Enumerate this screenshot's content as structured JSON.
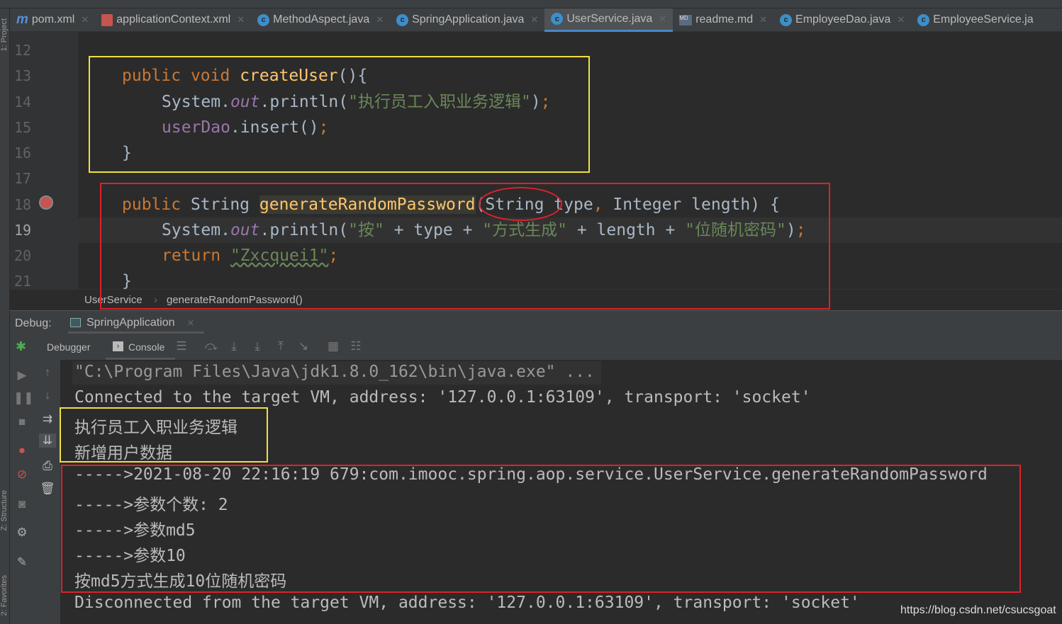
{
  "tabs": [
    {
      "label": "pom.xml",
      "icon": "maven-icon"
    },
    {
      "label": "applicationContext.xml",
      "icon": "spring-xml-icon"
    },
    {
      "label": "MethodAspect.java",
      "icon": "class-icon"
    },
    {
      "label": "SpringApplication.java",
      "icon": "run-class-icon"
    },
    {
      "label": "UserService.java",
      "icon": "class-icon",
      "active": true
    },
    {
      "label": "readme.md",
      "icon": "markdown-icon"
    },
    {
      "label": "EmployeeDao.java",
      "icon": "class-icon"
    },
    {
      "label": "EmployeeService.ja",
      "icon": "class-icon"
    }
  ],
  "side_labels": {
    "project": "1: Project",
    "structure": "Z: Structure",
    "favorites": "2: Favorites"
  },
  "line_numbers": [
    "12",
    "13",
    "14",
    "15",
    "16",
    "17",
    "18",
    "19",
    "20",
    "21"
  ],
  "code": {
    "l13": {
      "kw1": "public ",
      "kw2": "void ",
      "fn": "createUser",
      "rest": "(){"
    },
    "l14": {
      "a": "System.",
      "fld": "out",
      "b": ".println(",
      "st": "\"执行员工入职业务逻辑\"",
      "c": ")",
      "semi": ";"
    },
    "l15": {
      "mem": "userDao",
      "b": ".insert()",
      "semi": ";"
    },
    "l16": "}",
    "l18": {
      "kw1": "public ",
      "t": "String ",
      "fn": "generateRandomPassword",
      "b": "(String type",
      "comma": ", ",
      "c": "Integer length) {"
    },
    "l19": {
      "a": "System.",
      "fld": "out",
      "b": ".println(",
      "s1": "\"按\"",
      "c": " + type + ",
      "s2": "\"方式生成\"",
      "d": " + length + ",
      "s3": "\"位随机密码\"",
      "e": ")",
      "semi": ";"
    },
    "l20": {
      "kw": "return ",
      "st": "\"Zxcquei1\"",
      "semi": ";"
    },
    "l21": "}"
  },
  "breadcrumb": [
    "UserService",
    "generateRandomPassword()"
  ],
  "debug": {
    "label": "Debug:",
    "session": "SpringApplication",
    "debugger_tab": "Debugger",
    "console_tab": "Console"
  },
  "console": [
    "\"C:\\Program Files\\Java\\jdk1.8.0_162\\bin\\java.exe\" ...",
    "Connected to the target VM, address: '127.0.0.1:63109', transport: 'socket'",
    "执行员工入职业务逻辑",
    "新增用户数据",
    "----->2021-08-20 22:16:19 679:com.imooc.spring.aop.service.UserService.generateRandomPassword",
    "----->参数个数: 2",
    "----->参数md5",
    "----->参数10",
    "按md5方式生成10位随机密码",
    "Disconnected from the target VM, address: '127.0.0.1:63109', transport: 'socket'"
  ],
  "watermark": "https://blog.csdn.net/csucsgoat",
  "colors": {
    "highlight_yellow": "#f0e040",
    "highlight_red": "#e0202a"
  }
}
